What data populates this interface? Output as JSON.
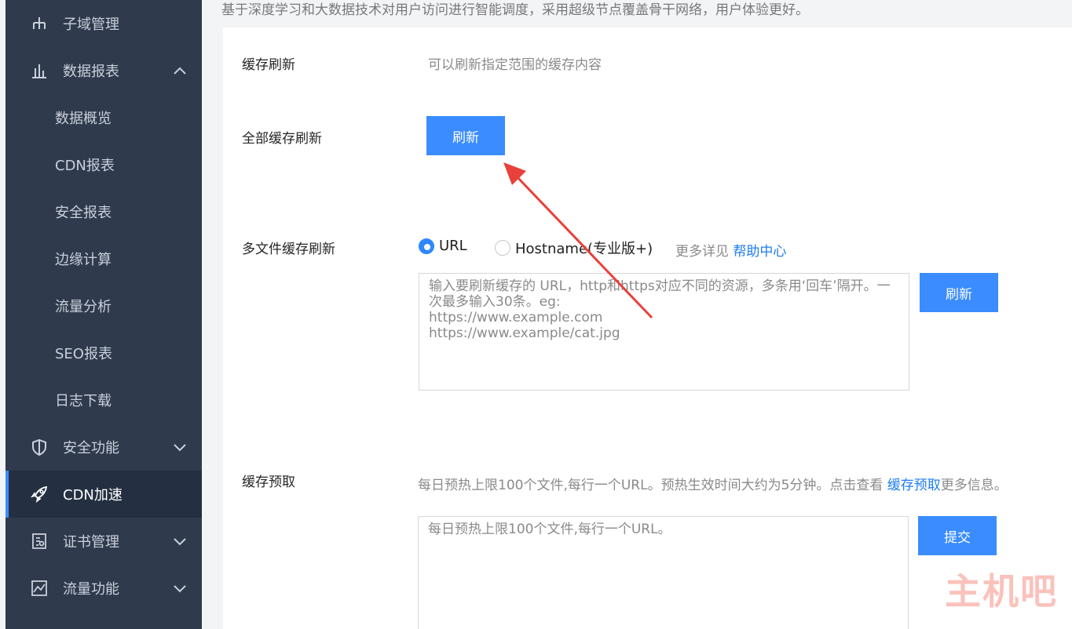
{
  "sidebar": {
    "items": [
      {
        "label": "子域管理",
        "icon": "sitemap-icon"
      },
      {
        "label": "数据报表",
        "icon": "bar-chart-icon",
        "chevron": "up"
      },
      {
        "label": "数据概览"
      },
      {
        "label": "CDN报表"
      },
      {
        "label": "安全报表"
      },
      {
        "label": "边缘计算"
      },
      {
        "label": "流量分析"
      },
      {
        "label": "SEO报表"
      },
      {
        "label": "日志下载"
      },
      {
        "label": "安全功能",
        "icon": "shield-icon",
        "chevron": "down"
      },
      {
        "label": "CDN加速",
        "icon": "rocket-icon",
        "active": true
      },
      {
        "label": "证书管理",
        "icon": "certificate-icon",
        "chevron": "down"
      },
      {
        "label": "流量功能",
        "icon": "line-chart-icon",
        "chevron": "down"
      }
    ]
  },
  "main": {
    "intro": "基于深度学习和大数据技术对用户访问进行智能调度，采用超级节点覆盖骨干网络，用户体验更好。",
    "cache_refresh": {
      "label": "缓存刷新",
      "desc": "可以刷新指定范围的缓存内容"
    },
    "full_refresh": {
      "label": "全部缓存刷新",
      "button": "刷新"
    },
    "multi_refresh": {
      "label": "多文件缓存刷新",
      "radio_url": "URL",
      "radio_host": "Hostname(专业版+)",
      "more_text": "更多详见",
      "help_link": "帮助中心",
      "placeholder": "输入要刷新缓存的 URL，http和https对应不同的资源，多条用‘回车’隔开。一次最多输入30条。eg:\nhttps://www.example.com\nhttps://www.example/cat.jpg",
      "button": "刷新"
    },
    "prefetch": {
      "label": "缓存预取",
      "desc_prefix": "每日预热上限100个文件,每行一个URL。预热生效时间大约为5分钟。点击查看 ",
      "desc_link": "缓存预取",
      "desc_suffix": "更多信息。",
      "placeholder": "每日预热上限100个文件,每行一个URL。",
      "button": "提交"
    },
    "watermark": "主机吧"
  },
  "colors": {
    "sidebar_bg": "#2f3a4d",
    "accent": "#3a8cff",
    "arrow": "#e8403a"
  }
}
